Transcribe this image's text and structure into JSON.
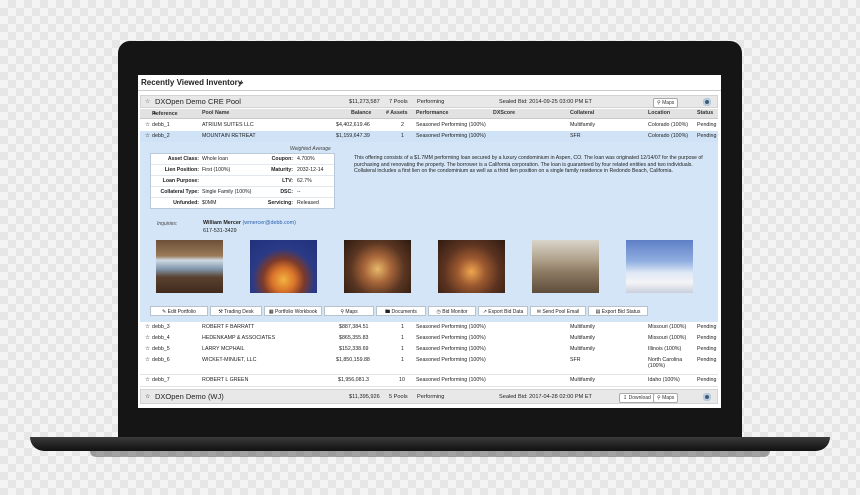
{
  "header": {
    "title": "Recently Viewed Inventory",
    "chevron": "chevron-down-icon"
  },
  "pools": [
    {
      "name": "DXOpen Demo CRE Pool",
      "balance": "$11,273,587",
      "pools": "7 Pools",
      "status": "Performing",
      "bid": "Sealed Bid: 2014-09-25 03:00 PM ET",
      "maps": "Maps"
    },
    {
      "name": "DXOpen Demo (WJ)",
      "balance": "$11,395,926",
      "pools": "5 Pools",
      "status": "Performing",
      "bid": "Sealed Bid: 2017-04-28 02:00 PM ET",
      "download": "Download",
      "maps": "Maps"
    }
  ],
  "columns": [
    "Reference",
    "Pool Name",
    "Balance",
    "# Assets",
    "Performance",
    "DXScore",
    "Collateral",
    "Location",
    "Status"
  ],
  "rows_top": [
    {
      "ref": "debb_1",
      "name": "ATRIUM SUITES LLC",
      "balance": "$4,402,619.46",
      "assets": "2",
      "perf": "Seasoned Performing (100%)",
      "coll": "Multifamily",
      "loc": "Colorado (100%)",
      "status": "Pending"
    },
    {
      "ref": "debb_2",
      "name": "MOUNTAIN RETREAT",
      "balance": "$1,159,647.39",
      "assets": "1",
      "perf": "Seasoned Performing (100%)",
      "coll": "SFR",
      "loc": "Colorado (100%)",
      "status": "Pending"
    }
  ],
  "detail": {
    "weighted": "Weighted Average",
    "fields": [
      {
        "l1": "Asset Class:",
        "v1": "Whole loan",
        "l2": "Coupon:",
        "v2": "4.700%"
      },
      {
        "l1": "Lien Position:",
        "v1": "First (100%)",
        "l2": "Maturity:",
        "v2": "2032-12-14"
      },
      {
        "l1": "Loan Purpose:",
        "v1": "",
        "l2": "LTV:",
        "v2": "62.7%"
      },
      {
        "l1": "Collateral Type:",
        "v1": "Single Family (100%)",
        "l2": "DSC:",
        "v2": "--"
      },
      {
        "l1": "Unfunded:",
        "v1": "$0MM",
        "l2": "Servicing:",
        "v2": "Released"
      }
    ],
    "description": "This offering consists of a $1.7MM performing loan secured by a luxury condominium in Aspen, CO. The loan was originated 12/14/07 for the purpose of purchasing and renovating the property. The borrower is a California corporation. The loan is guaranteed by four related entities and two individuals. Collateral includes a first lien on the condominium as well as a third lien position on a single family residence in Redondo Beach, California.",
    "inquiries_label": "Inquiries:",
    "contact_name": "William Mercer",
    "contact_email": "(wmercer@debb.com)",
    "contact_phone": "617-531-3429",
    "actions": [
      "Edit Portfolio",
      "Trading Desk",
      "Portfolio Workbook",
      "Maps",
      "Documents",
      "Bid Monitor",
      "Export Bid Data",
      "Send Pool Email",
      "Export Bid Status"
    ]
  },
  "rows_bottom": [
    {
      "ref": "debb_3",
      "name": "ROBERT F BARRATT",
      "balance": "$887,384.51",
      "assets": "1",
      "perf": "Seasoned Performing (100%)",
      "coll": "Multifamily",
      "loc": "Missouri (100%)",
      "status": "Pending"
    },
    {
      "ref": "debb_4",
      "name": "HEDENKAMP & ASSOCIATES",
      "balance": "$865,355.83",
      "assets": "1",
      "perf": "Seasoned Performing (100%)",
      "coll": "Multifamily",
      "loc": "Missouri (100%)",
      "status": "Pending"
    },
    {
      "ref": "debb_5",
      "name": "LARRY MCPHAIL",
      "balance": "$152,338.69",
      "assets": "1",
      "perf": "Seasoned Performing (100%)",
      "coll": "Multifamily",
      "loc": "Illinois (100%)",
      "status": "Pending"
    },
    {
      "ref": "debb_6",
      "name": "WICKET-MINUET, LLC",
      "balance": "$1,850,159.88",
      "assets": "1",
      "perf": "Seasoned Performing (100%)",
      "coll": "SFR",
      "loc": "North Carolina (100%)",
      "status": "Pending"
    },
    {
      "ref": "debb_7",
      "name": "ROBERT L GREEN",
      "balance": "$1,956,081.3",
      "assets": "10",
      "perf": "Seasoned Performing (100%)",
      "coll": "Multifamily",
      "loc": "Idaho (100%)",
      "status": "Pending"
    }
  ]
}
